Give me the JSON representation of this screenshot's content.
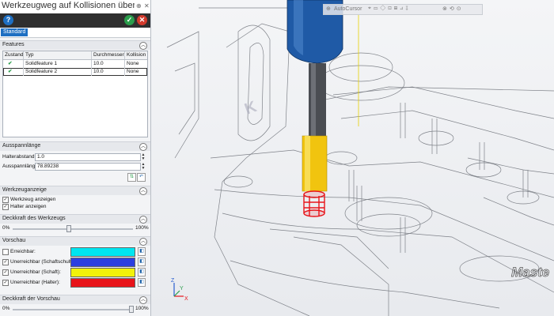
{
  "window": {
    "title": "Werkzeugweg auf Kollisionen überprüf...",
    "pin_glyph": "⊕",
    "close_glyph": "✕"
  },
  "toolbar": {
    "help_glyph": "?",
    "ok_glyph": "✓",
    "cancel_glyph": "✕"
  },
  "tabs": [
    {
      "label": "Standard"
    }
  ],
  "features": {
    "header": "Features",
    "columns": [
      "Zustand",
      "Typ",
      "Durchmesser",
      "Kollision"
    ],
    "rows": [
      {
        "status": "✔",
        "type": "Solidfeature 1",
        "diameter": "10.0",
        "collision": "None"
      },
      {
        "status": "✔",
        "type": "Solidfeature 2",
        "diameter": "10.0",
        "collision": "None"
      }
    ]
  },
  "ausspannlaenge": {
    "header": "Ausspannlänge",
    "halterabstand_label": "Halterabstand:",
    "halterabstand_value": "1.0",
    "laenge_label": "Ausspannlänge:",
    "laenge_value": "78.89238"
  },
  "werkzeuganzeige": {
    "header": "Werkzeuganzeige",
    "show_tool_label": "Werkzeug anzeigen",
    "show_holder_label": "Halter anzeigen",
    "show_tool_checked": true,
    "show_holder_checked": true
  },
  "deckkraft_werkzeug": {
    "header": "Deckkraft des Werkzeugs",
    "min_label": "0%",
    "max_label": "100%",
    "value": 0.45
  },
  "vorschau": {
    "header": "Vorschau",
    "items": [
      {
        "label": "Erreichbar:",
        "checked": false,
        "color": "#00e5f0"
      },
      {
        "label": "Unerreichbar (Schaftschulter):",
        "checked": true,
        "color": "#2c3fe0"
      },
      {
        "label": "Unerreichbar (Schaft):",
        "checked": true,
        "color": "#f2f20a"
      },
      {
        "label": "Unerreichbar (Halter):",
        "checked": true,
        "color": "#e8141a"
      }
    ]
  },
  "deckkraft_vorschau": {
    "header": "Deckkraft der Vorschau",
    "min_label": "0%",
    "max_label": "100%",
    "value": 1.0
  },
  "viewport": {
    "autocursor_label": "AutoCursor",
    "axis_x": "X",
    "axis_y": "Y",
    "axis_z": "Z",
    "part_text": "Maste"
  },
  "colors": {
    "accent": "#1e6fc2",
    "tool_holder_blue": "#1f5aa6",
    "tool_shaft_yellow": "#f1c40f",
    "collision_red": "#e8141a"
  }
}
